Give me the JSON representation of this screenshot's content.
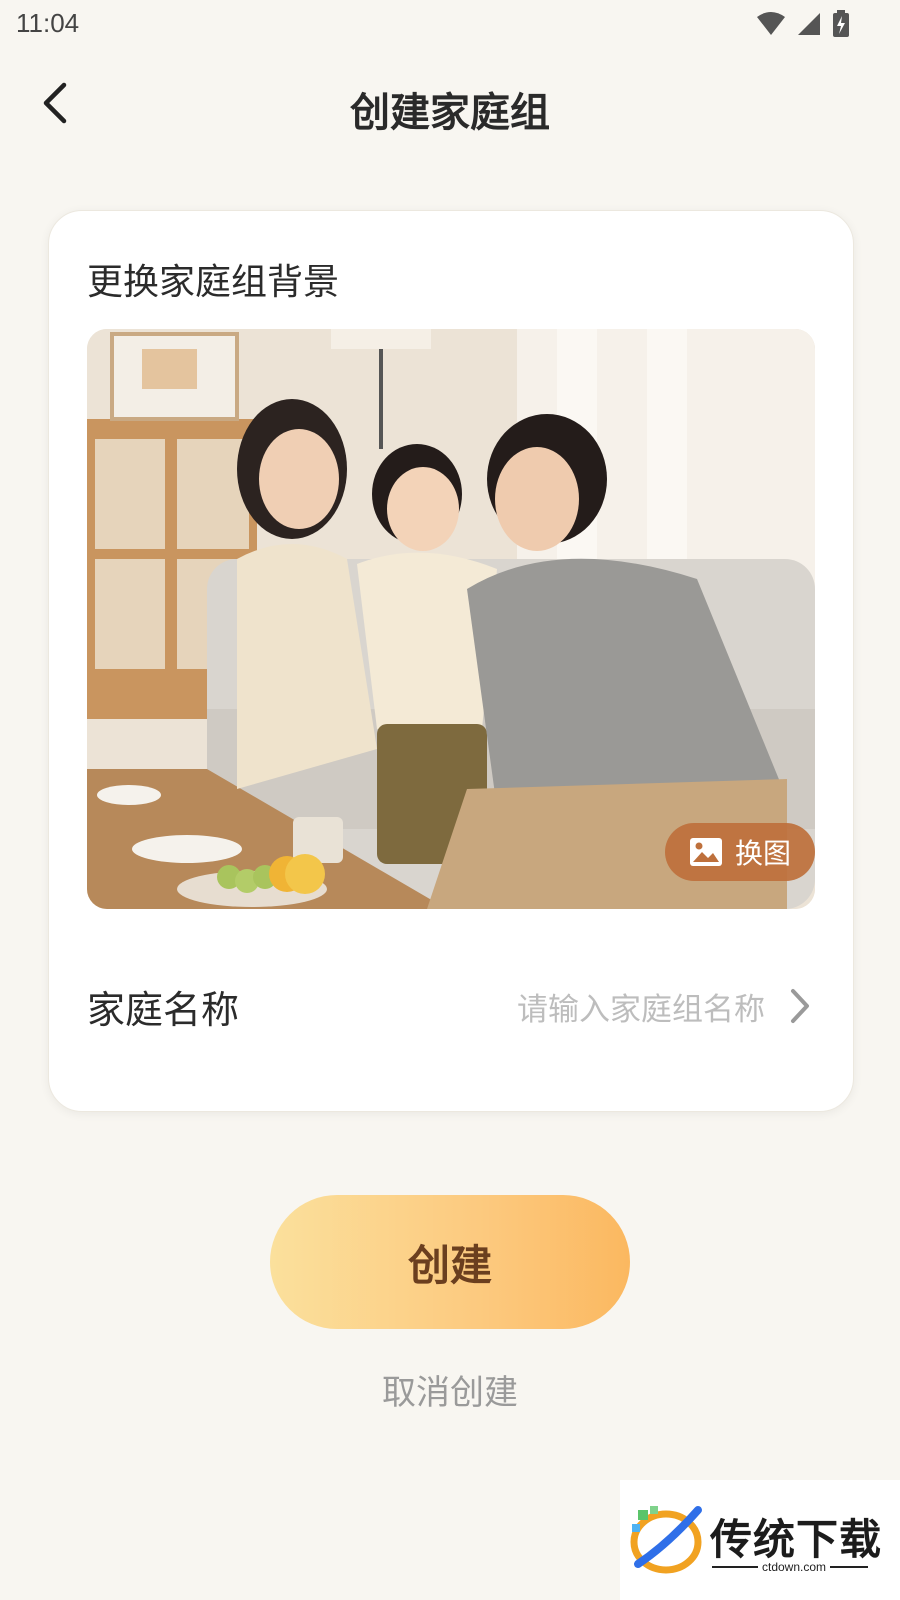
{
  "status_bar": {
    "time": "11:04",
    "icons": [
      "wifi-icon",
      "signal-icon",
      "battery-charging-icon"
    ]
  },
  "header": {
    "title": "创建家庭组",
    "back_icon": "chevron-left-icon"
  },
  "card": {
    "background_section_title": "更换家庭组背景",
    "change_image_label": "换图",
    "change_image_icon": "image-icon",
    "name_label": "家庭名称",
    "name_placeholder": "请输入家庭组名称"
  },
  "actions": {
    "create_label": "创建",
    "cancel_label": "取消创建"
  },
  "watermark": {
    "title": "传统下载",
    "url": "ctdown.com"
  },
  "colors": {
    "page_background": "#f8f6f1",
    "create_gradient_start": "#fbe09c",
    "create_gradient_end": "#fbb860",
    "create_text": "#6b3f1f",
    "change_image_bg": "#be703c"
  }
}
